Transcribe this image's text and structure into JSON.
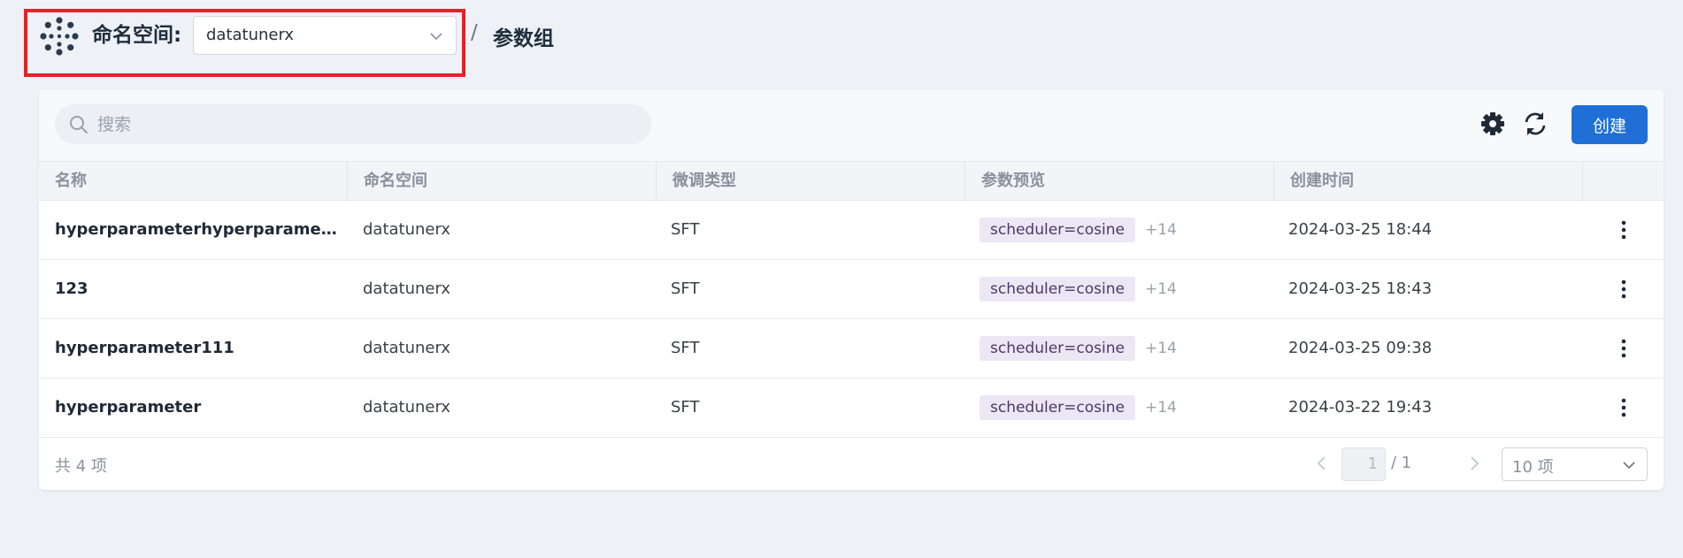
{
  "header": {
    "namespace_label": "命名空间:",
    "namespace_value": "datatunerx",
    "separator": "/",
    "current_page": "参数组"
  },
  "toolbar": {
    "search_placeholder": "搜索",
    "create_label": "创建",
    "icons": [
      "gear-icon",
      "refresh-icon"
    ]
  },
  "table": {
    "columns": [
      "名称",
      "命名空间",
      "微调类型",
      "参数预览",
      "创建时间",
      ""
    ],
    "rows": [
      {
        "name": "hyperparameterhyperparameterh...",
        "namespace": "datatunerx",
        "type": "SFT",
        "tag": "scheduler=cosine",
        "more": "+14",
        "created": "2024-03-25 18:44"
      },
      {
        "name": "123",
        "namespace": "datatunerx",
        "type": "SFT",
        "tag": "scheduler=cosine",
        "more": "+14",
        "created": "2024-03-25 18:43"
      },
      {
        "name": "hyperparameter111",
        "namespace": "datatunerx",
        "type": "SFT",
        "tag": "scheduler=cosine",
        "more": "+14",
        "created": "2024-03-25 09:38"
      },
      {
        "name": "hyperparameter",
        "namespace": "datatunerx",
        "type": "SFT",
        "tag": "scheduler=cosine",
        "more": "+14",
        "created": "2024-03-22 19:43"
      }
    ]
  },
  "pagination": {
    "total_text": "共 4 项",
    "current_page": "1",
    "page_total": "/ 1",
    "page_size": "10 项"
  },
  "colors": {
    "accent": "#1f6fd6",
    "highlight_border": "#e0242a",
    "tag_bg": "#ece6f5"
  }
}
